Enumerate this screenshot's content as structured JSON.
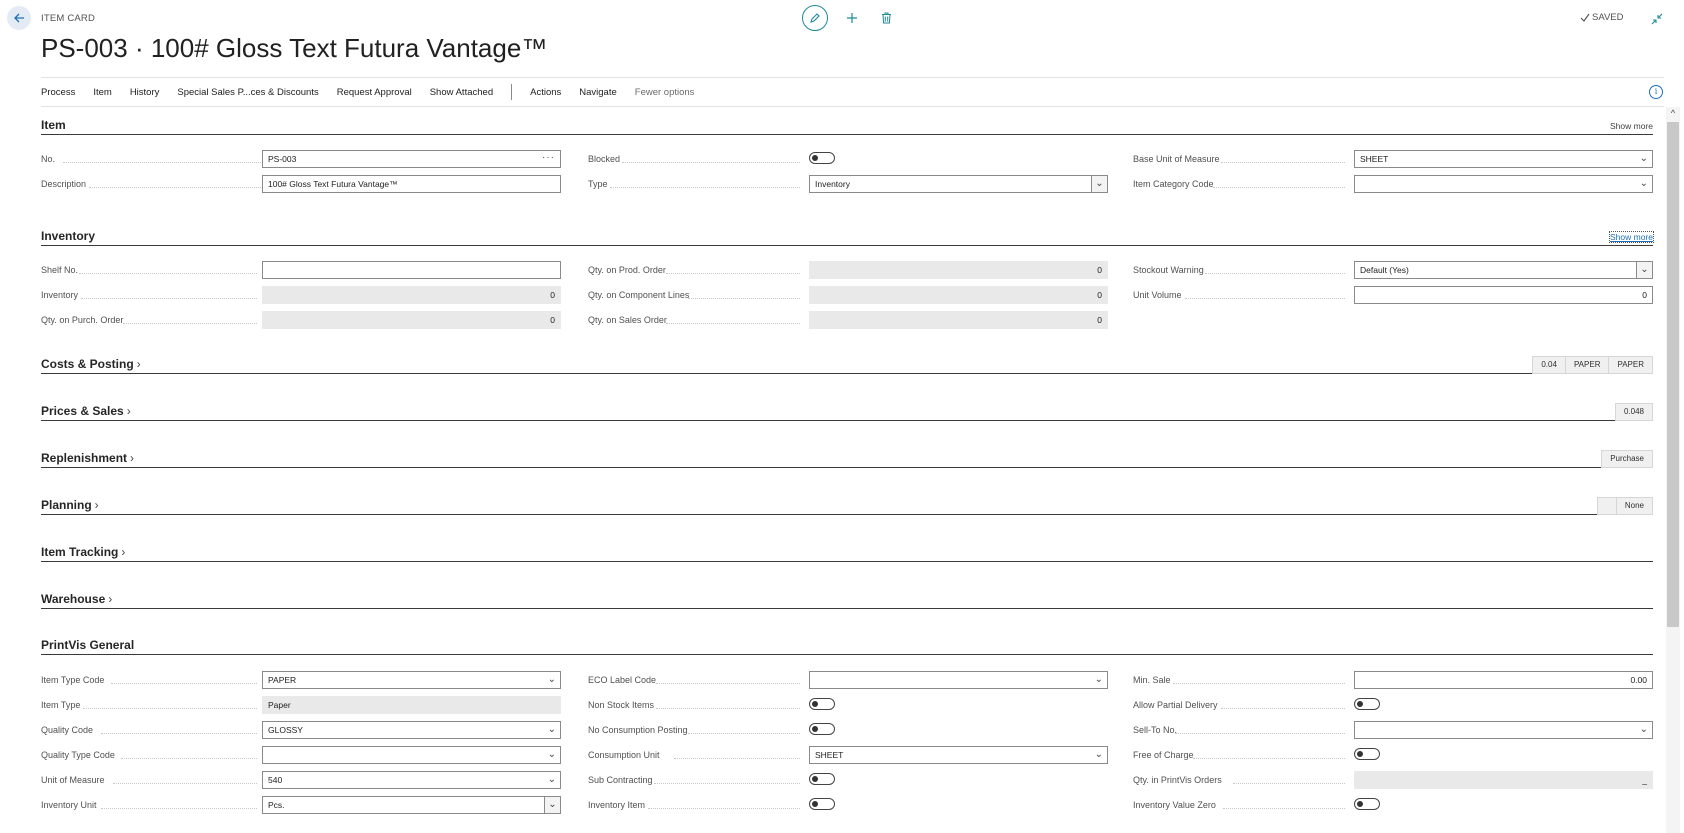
{
  "header": {
    "page_kind": "ITEM CARD",
    "title": "PS-003 · 100# Gloss Text Futura Vantage™",
    "status": "SAVED"
  },
  "icons": {
    "back": "arrow-left-icon",
    "edit": "pencil-icon",
    "new": "plus-icon",
    "delete": "trash-icon",
    "saved": "checkmark-icon",
    "collapse": "collapse-arrows-icon",
    "info": "info-icon"
  },
  "actions": {
    "items": [
      "Process",
      "Item",
      "History",
      "Special Sales P...ces & Discounts",
      "Request Approval",
      "Show Attached"
    ],
    "secondary": [
      "Actions",
      "Navigate"
    ],
    "fewer": "Fewer options"
  },
  "sections": {
    "item": {
      "title": "Item",
      "show_more": "Show more",
      "no_label": "No.",
      "no_value": "PS-003",
      "description_label": "Description",
      "description_value": "100# Gloss Text Futura Vantage™",
      "blocked_label": "Blocked",
      "type_label": "Type",
      "type_value": "Inventory",
      "base_uom_label": "Base Unit of Measure",
      "base_uom_value": "SHEET",
      "item_category_label": "Item Category Code",
      "item_category_value": ""
    },
    "inventory": {
      "title": "Inventory",
      "show_more": "Show more",
      "shelf_no_label": "Shelf No.",
      "shelf_no_value": "",
      "inventory_label": "Inventory",
      "inventory_value": "0",
      "qty_purch_label": "Qty. on Purch. Order",
      "qty_purch_value": "0",
      "qty_prod_label": "Qty. on Prod. Order",
      "qty_prod_value": "0",
      "qty_component_label": "Qty. on Component Lines",
      "qty_component_value": "0",
      "qty_sales_label": "Qty. on Sales Order",
      "qty_sales_value": "0",
      "stockout_label": "Stockout Warning",
      "stockout_value": "Default (Yes)",
      "unit_volume_label": "Unit Volume",
      "unit_volume_value": "0"
    },
    "costs": {
      "title": "Costs & Posting",
      "badges": [
        "0.04",
        "PAPER",
        "PAPER"
      ]
    },
    "prices": {
      "title": "Prices & Sales",
      "badges": [
        "0.048"
      ]
    },
    "replenishment": {
      "title": "Replenishment",
      "badges": [
        "Purchase"
      ]
    },
    "planning": {
      "title": "Planning",
      "badges": [
        "",
        "None"
      ]
    },
    "tracking": {
      "title": "Item Tracking"
    },
    "warehouse": {
      "title": "Warehouse"
    },
    "printvis": {
      "title": "PrintVis General",
      "item_type_code_label": "Item Type Code",
      "item_type_code_value": "PAPER",
      "item_type_label": "Item Type",
      "item_type_value": "Paper",
      "quality_code_label": "Quality Code",
      "quality_code_value": "GLOSSY",
      "quality_type_code_label": "Quality Type Code",
      "quality_type_code_value": "",
      "uom_label": "Unit of Measure",
      "uom_value": "540",
      "inventory_unit_label": "Inventory Unit",
      "inventory_unit_value": "Pcs.",
      "eco_label": "ECO Label Code",
      "eco_value": "",
      "non_stock_label": "Non Stock Items",
      "no_consumption_label": "No Consumption Posting",
      "consumption_unit_label": "Consumption Unit",
      "consumption_unit_value": "SHEET",
      "sub_contracting_label": "Sub Contracting",
      "inventory_item_label": "Inventory Item",
      "min_sale_label": "Min. Sale",
      "min_sale_value": "0.00",
      "allow_partial_label": "Allow Partial Delivery",
      "sell_to_label": "Sell-To No.",
      "sell_to_value": "",
      "free_charge_label": "Free of Charge",
      "qty_printvis_label": "Qty. in PrintVis Orders",
      "qty_printvis_value": "_",
      "inventory_value_zero_label": "Inventory Value Zero"
    }
  }
}
